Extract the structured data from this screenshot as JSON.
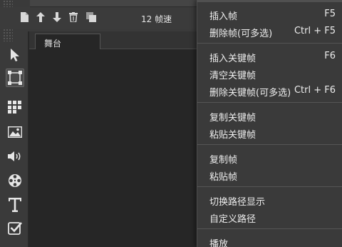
{
  "toolbar": {
    "fps_label": "12 帧速",
    "icons": [
      "new-file-icon",
      "move-up-icon",
      "move-down-icon",
      "trash-icon",
      "copy-icon"
    ]
  },
  "stage": {
    "tab_label": "舞台"
  },
  "tools": [
    "select-arrow-icon",
    "transform-icon",
    "grid-icon",
    "image-icon",
    "sound-icon",
    "film-reel-icon",
    "text-icon",
    "checkbox-icon"
  ],
  "menu": {
    "groups": [
      [
        {
          "label": "插入帧",
          "shortcut": "F5"
        },
        {
          "label": "删除帧(可多选)",
          "shortcut": "Ctrl + F5"
        }
      ],
      [
        {
          "label": "插入关键帧",
          "shortcut": "F6"
        },
        {
          "label": "清空关键帧",
          "shortcut": ""
        },
        {
          "label": "删除关键帧(可多选)",
          "shortcut": "Ctrl + F6"
        }
      ],
      [
        {
          "label": "复制关键帧",
          "shortcut": ""
        },
        {
          "label": "粘贴关键帧",
          "shortcut": ""
        }
      ],
      [
        {
          "label": "复制帧",
          "shortcut": ""
        },
        {
          "label": "粘贴帧",
          "shortcut": ""
        }
      ],
      [
        {
          "label": "切换路径显示",
          "shortcut": ""
        },
        {
          "label": "自定义路径",
          "shortcut": ""
        }
      ],
      [
        {
          "label": "播放",
          "shortcut": ""
        }
      ]
    ]
  },
  "colors": {
    "background": "#262626",
    "panel": "#3a3a3a",
    "menu_text": "#ededed"
  }
}
